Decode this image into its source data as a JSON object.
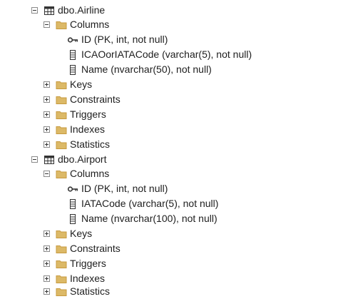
{
  "tree": {
    "tables": [
      {
        "name": "dbo.Airline",
        "table_icon": "table-icon",
        "columns_folder": {
          "label": "Columns",
          "icon": "folder-icon",
          "items": [
            {
              "label": "ID (PK, int, not null)",
              "icon": "key-icon"
            },
            {
              "label": "ICAOorIATACode (varchar(5), not null)",
              "icon": "column-icon"
            },
            {
              "label": "Name (nvarchar(50), not null)",
              "icon": "column-icon"
            }
          ]
        },
        "folders": [
          {
            "label": "Keys",
            "icon": "folder-icon"
          },
          {
            "label": "Constraints",
            "icon": "folder-icon"
          },
          {
            "label": "Triggers",
            "icon": "folder-icon"
          },
          {
            "label": "Indexes",
            "icon": "folder-icon"
          },
          {
            "label": "Statistics",
            "icon": "folder-icon"
          }
        ]
      },
      {
        "name": "dbo.Airport",
        "table_icon": "table-icon",
        "columns_folder": {
          "label": "Columns",
          "icon": "folder-icon",
          "items": [
            {
              "label": "ID (PK, int, not null)",
              "icon": "key-icon"
            },
            {
              "label": "IATACode (varchar(5), not null)",
              "icon": "column-icon"
            },
            {
              "label": "Name (nvarchar(100), not null)",
              "icon": "column-icon"
            }
          ]
        },
        "folders": [
          {
            "label": "Keys",
            "icon": "folder-icon"
          },
          {
            "label": "Constraints",
            "icon": "folder-icon"
          },
          {
            "label": "Triggers",
            "icon": "folder-icon"
          },
          {
            "label": "Indexes",
            "icon": "folder-icon"
          },
          {
            "label": "Statistics",
            "icon": "folder-icon"
          }
        ]
      }
    ]
  },
  "colors": {
    "folder": "#dcb967",
    "folder_dark": "#c79a3f",
    "text": "#1e1e1e",
    "expander_border": "#8a8a8a"
  }
}
